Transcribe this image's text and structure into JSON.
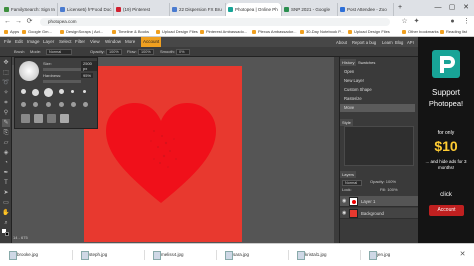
{
  "browser": {
    "tabs": [
      {
        "title": "FamilySearch: Sign In",
        "fav_color": "#3d8f3d"
      },
      {
        "title": "License5) h*Food Doc",
        "fav_color": "#4a7bd0"
      },
      {
        "title": "(19) Pinterest",
        "fav_color": "#d02030"
      },
      {
        "title": "22 Dispersion FX Bru",
        "fav_color": "#4a7bd0"
      },
      {
        "title": "Photopea | Online Ph",
        "fav_color": "#18a497"
      },
      {
        "title": "SNP 2021 - Google",
        "fav_color": "#2a8f4f"
      },
      {
        "title": "Post Attendee - Zoo",
        "fav_color": "#2d6fd8"
      }
    ],
    "new_tab": "+",
    "window_controls": [
      "—",
      "▢",
      "✕"
    ],
    "nav": [
      "←",
      "→",
      "⟳"
    ],
    "url": "photopea.com",
    "bookmarks": [
      "Apps",
      "Google Gm...",
      "DesignScraps | Act...",
      "Timeline & Books",
      "Upload Design Files",
      "Pinterest Ambassado...",
      "Plexus Ambassador...",
      "30-Day Notebook P...",
      "Upload Design Files",
      "Other bookmarks",
      "Reading list"
    ]
  },
  "photopea": {
    "menu": [
      "File",
      "Edit",
      "Image",
      "Layer",
      "Select",
      "Filter",
      "View",
      "Window",
      "More",
      "Account"
    ],
    "options": {
      "tool_label": "Brush",
      "mode_label": "Mode:",
      "mode_value": "Normal",
      "opacity_label": "Opacity:",
      "opacity_value": "100%",
      "flow_label": "Flow:",
      "flow_value": "100%",
      "smooth_label": "Smooth:",
      "smooth_value": "0%"
    },
    "doc_tab": "ShopAd125x125.1 ×",
    "brush_popup": {
      "size_label": "Size:",
      "size_value": "2500 px",
      "hardness_label": "Hardness:",
      "hardness_value": "95%"
    },
    "zoom": "14 - 675",
    "right_top": [
      "About",
      "Report a bug",
      "Learn",
      "Blog",
      "API"
    ],
    "panel_tabs": [
      "History",
      "Swatches"
    ],
    "history": [
      "Open",
      "New Layer",
      "Custom Shape",
      "Rasterize",
      "Move"
    ],
    "style_tab": "Style",
    "layers_tab": "Layers",
    "layers_blend": "Normal",
    "layers_opacity": "Opacity: 100%",
    "layers_lock": "Lock:",
    "layers_fill": "Fill: 100%",
    "layers": [
      {
        "name": "Layer 1"
      },
      {
        "name": "Background"
      }
    ]
  },
  "ad": {
    "line1": "Support",
    "line2": "Photopea!",
    "for_only": "for only",
    "price": "$10",
    "hide_ads": "... and hide ads for 3 months!",
    "click": "click",
    "button": "Account"
  },
  "downloads": [
    "brooke.jpg",
    "steph.jpg",
    "meliss4.jpg",
    "sara.jpg",
    "kristal1.jpg",
    "jen.jpg"
  ],
  "colors": {
    "canvas": "#e8392f",
    "heart": "#f0101a",
    "ad_accent": "#18a497",
    "account_button": "#c02020",
    "selected_tool": "#f0a020"
  }
}
